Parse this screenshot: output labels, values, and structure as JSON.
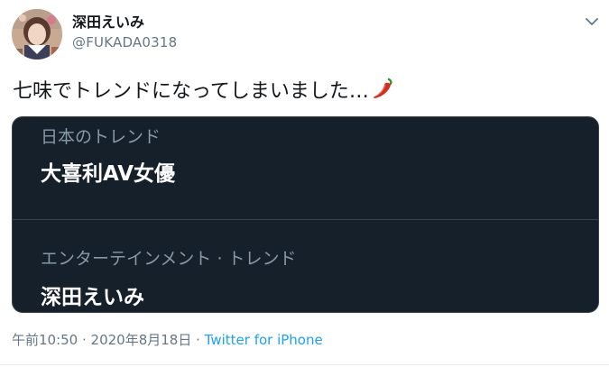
{
  "user": {
    "display_name": "深田えいみ",
    "handle": "@FUKADA0318"
  },
  "tweet": {
    "text": "七味でトレンドになってしまいました…",
    "emoji_icon": "chili-pepper-icon"
  },
  "card": {
    "trends": [
      {
        "context": "日本のトレンド",
        "name": "大喜利AV女優"
      },
      {
        "context": "エンターテインメント · トレンド",
        "name": "深田えいみ"
      }
    ]
  },
  "meta": {
    "timestamp": "午前10:50 · 2020年8月18日",
    "separator": " · ",
    "source": "Twitter for iPhone"
  },
  "colors": {
    "card_background": "#15202b",
    "link": "#1da1f2",
    "secondary_text": "#657786"
  }
}
